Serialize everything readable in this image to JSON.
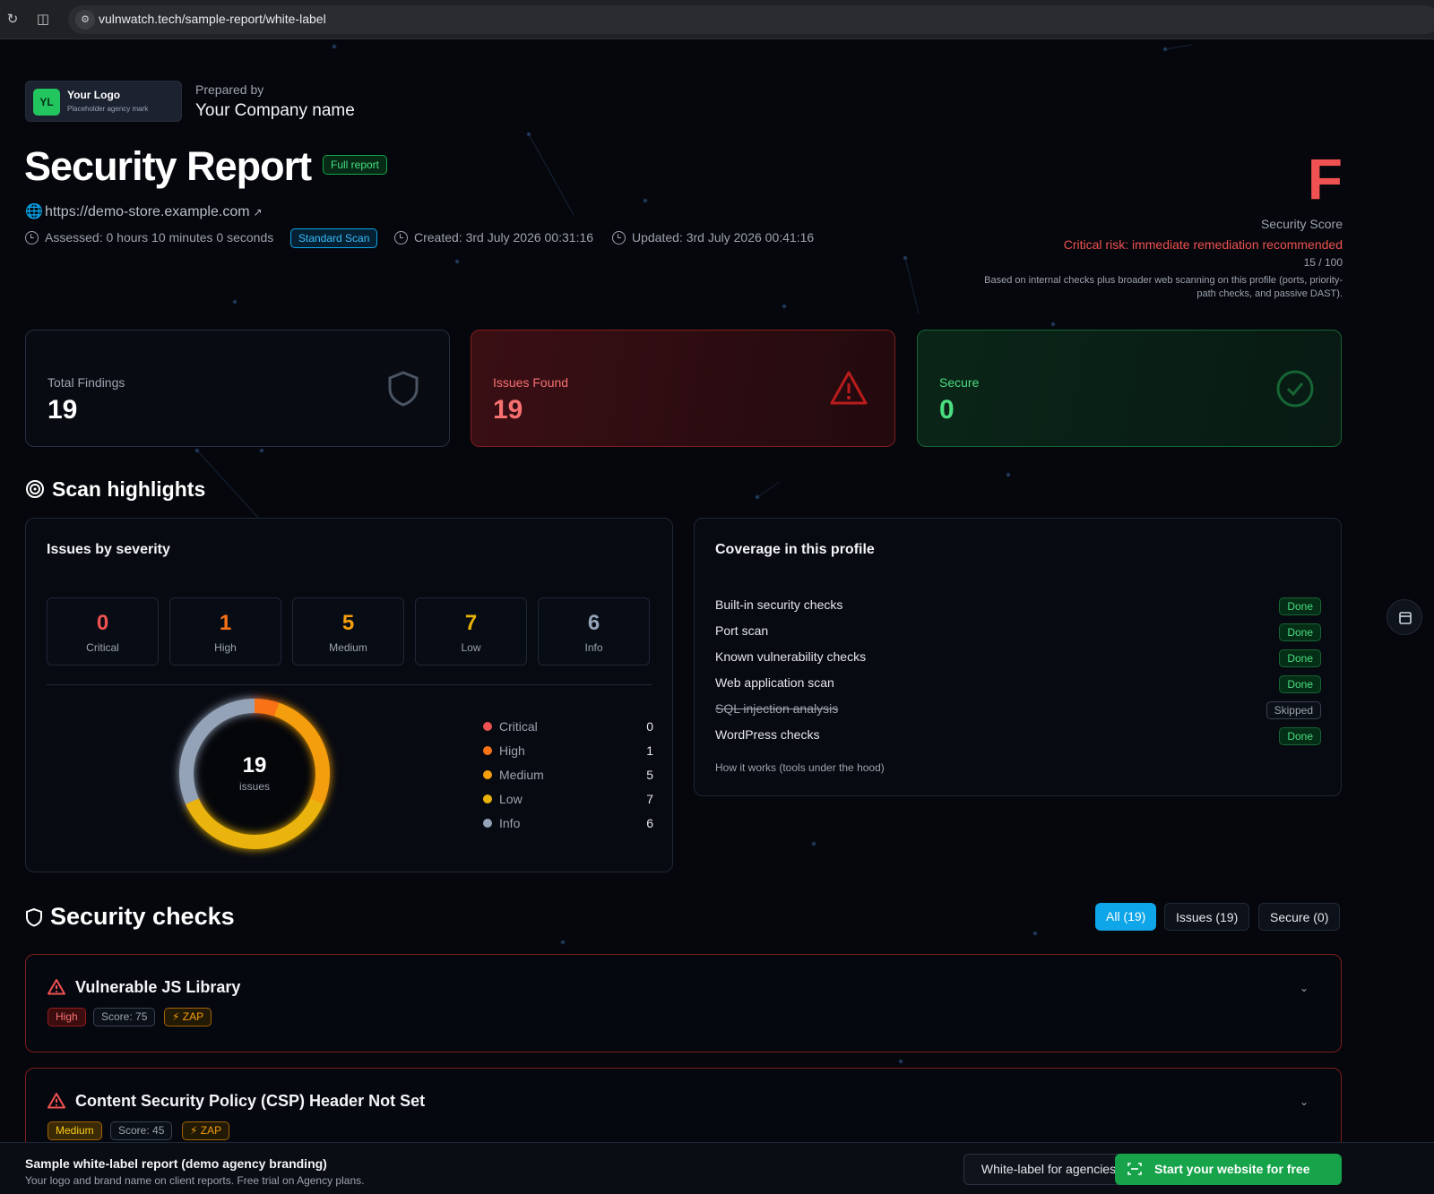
{
  "browser": {
    "url": "vulnwatch.tech/sample-report/white-label"
  },
  "brand": {
    "logo_initials": "YL",
    "logo_title": "Your Logo",
    "logo_sub": "Placeholder agency mark",
    "prepared_label": "Prepared by",
    "company": "Your Company name"
  },
  "report": {
    "title": "Security Report",
    "badge": "Full report",
    "site_url": "https://demo-store.example.com",
    "assessed": "Assessed: 0 hours 10 minutes 0 seconds",
    "scan_type": "Standard Scan",
    "created": "Created: 3rd July 2026 00:31:16",
    "updated": "Updated: 3rd July 2026 00:41:16"
  },
  "score": {
    "grade": "F",
    "label": "Security Score",
    "risk": "Critical risk: immediate remediation recommended",
    "value": "15 / 100",
    "basis": "Based on internal checks plus broader web scanning on this profile (ports, priority-path checks, and passive DAST)."
  },
  "stats": [
    {
      "label": "Total Findings",
      "value": "19"
    },
    {
      "label": "Issues Found",
      "value": "19"
    },
    {
      "label": "Secure",
      "value": "0"
    }
  ],
  "highlights": {
    "heading": "Scan highlights",
    "severity_title": "Issues by severity",
    "severity": [
      {
        "label": "Critical",
        "value": "0",
        "color": "#f05252"
      },
      {
        "label": "High",
        "value": "1",
        "color": "#f97316"
      },
      {
        "label": "Medium",
        "value": "5",
        "color": "#f59e0b"
      },
      {
        "label": "Low",
        "value": "7",
        "color": "#eab308"
      },
      {
        "label": "Info",
        "value": "6",
        "color": "#94a3b8"
      }
    ],
    "donut_total": "19",
    "donut_label": "issues",
    "coverage_title": "Coverage in this profile",
    "coverage": [
      {
        "label": "Built-in security checks",
        "status": "Done"
      },
      {
        "label": "Port scan",
        "status": "Done"
      },
      {
        "label": "Known vulnerability checks",
        "status": "Done"
      },
      {
        "label": "Web application scan",
        "status": "Done"
      },
      {
        "label": "SQL injection analysis",
        "status": "Skipped"
      },
      {
        "label": "WordPress checks",
        "status": "Done"
      }
    ],
    "how_link": "How it works  (tools under the hood)"
  },
  "checks": {
    "heading": "Security checks",
    "filters": [
      "All (19)",
      "Issues (19)",
      "Secure (0)"
    ],
    "items": [
      {
        "title": "Vulnerable JS Library",
        "severity": "High",
        "score": "Score: 75",
        "tool": "ZAP"
      },
      {
        "title": "Content Security Policy (CSP) Header Not Set",
        "severity": "Medium",
        "score": "Score: 45",
        "tool": "ZAP"
      }
    ]
  },
  "footer": {
    "title": "Sample white-label report (demo agency branding)",
    "sub": "Your logo and brand name on client reports. Free trial on Agency plans.",
    "agency_btn": "White-label for agencies",
    "start_btn": "Start your website for free"
  }
}
